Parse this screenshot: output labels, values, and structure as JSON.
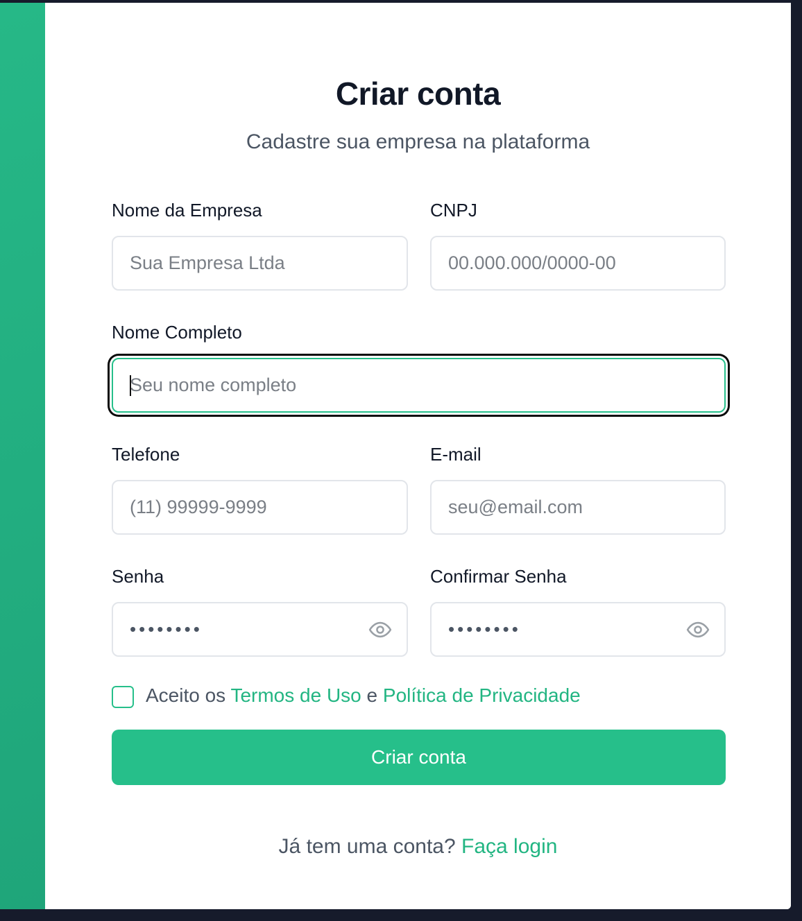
{
  "header": {
    "title": "Criar conta",
    "subtitle": "Cadastre sua empresa na plataforma"
  },
  "form": {
    "company_name": {
      "label": "Nome da Empresa",
      "placeholder": "Sua Empresa Ltda",
      "value": ""
    },
    "cnpj": {
      "label": "CNPJ",
      "placeholder": "00.000.000/0000-00",
      "value": ""
    },
    "full_name": {
      "label": "Nome Completo",
      "placeholder": "Seu nome completo",
      "value": ""
    },
    "phone": {
      "label": "Telefone",
      "placeholder": "(11) 99999-9999",
      "value": ""
    },
    "email": {
      "label": "E-mail",
      "placeholder": "seu@email.com",
      "value": ""
    },
    "password": {
      "label": "Senha",
      "masked_value": "••••••••",
      "toggle_icon": "eye-icon"
    },
    "confirm_password": {
      "label": "Confirmar Senha",
      "masked_value": "••••••••",
      "toggle_icon": "eye-icon"
    }
  },
  "terms": {
    "prefix": "Aceito os",
    "terms_link": "Termos de Uso",
    "conjunction": "e",
    "privacy_link": "Política de Privacidade",
    "checked": false
  },
  "submit_label": "Criar conta",
  "footer": {
    "question": "Já tem uma conta?",
    "login_link": "Faça login"
  },
  "colors": {
    "accent": "#26bf8a",
    "title": "#111827",
    "muted": "#4b5563",
    "background": "#161b2b"
  }
}
